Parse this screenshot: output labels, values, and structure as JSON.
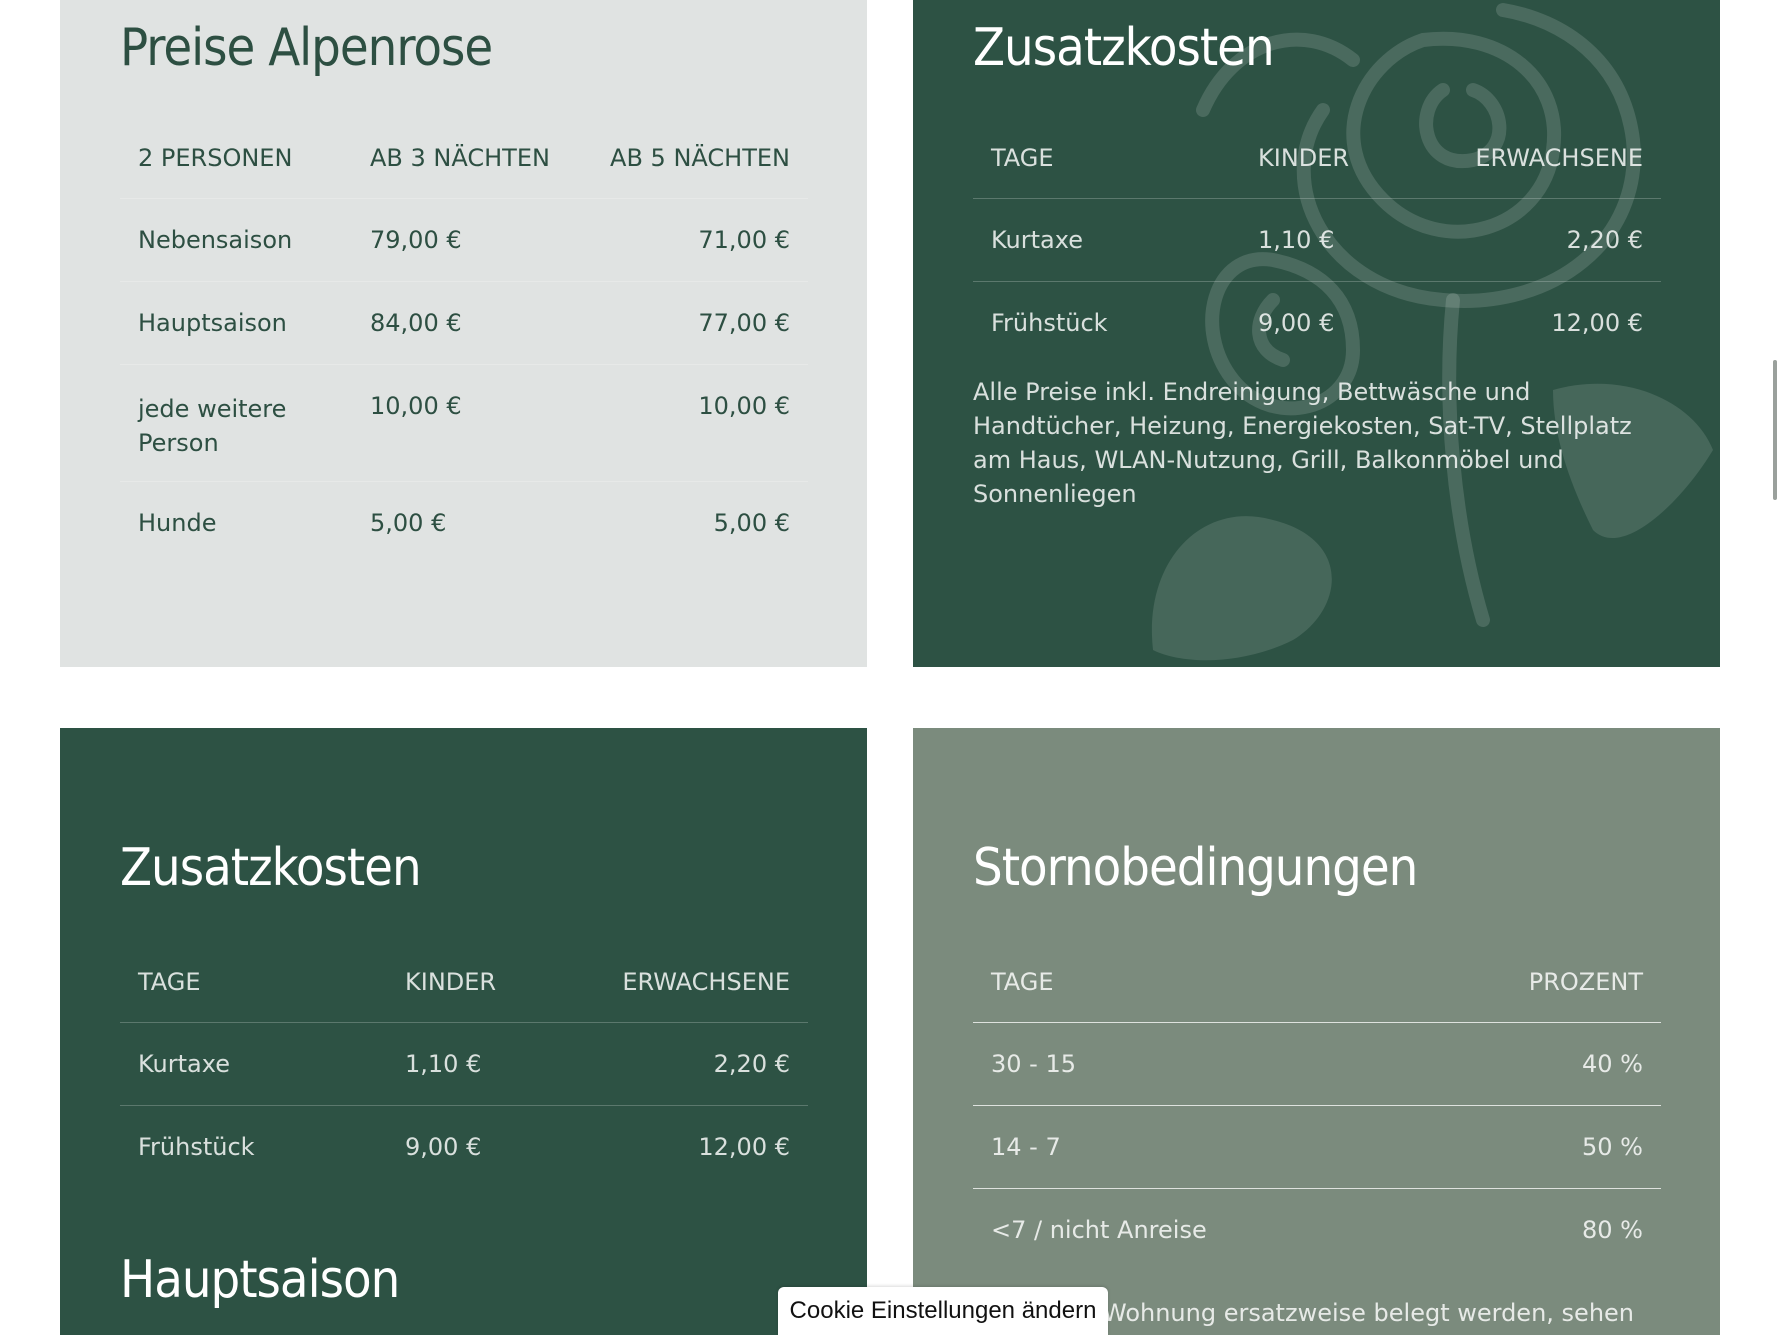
{
  "preise": {
    "title": "Preise Alpenrose",
    "headers": [
      "2 PERSONEN",
      "AB 3 NÄCHTEN",
      "AB 5 NÄCHTEN"
    ],
    "rows": [
      [
        "Nebensaison",
        "79,00 €",
        "71,00 €"
      ],
      [
        "Hauptsaison",
        "84,00 €",
        "77,00 €"
      ],
      [
        "jede weitere Person",
        "10,00 €",
        "10,00 €"
      ],
      [
        "Hunde",
        "5,00 €",
        "5,00 €"
      ]
    ]
  },
  "zusatzkosten_top": {
    "title": "Zusatzkosten",
    "headers": [
      "TAGE",
      "KINDER",
      "ERWACHSENE"
    ],
    "rows": [
      [
        "Kurtaxe",
        "1,10 €",
        "2,20 €"
      ],
      [
        "Frühstück",
        "9,00 €",
        "12,00 €"
      ]
    ],
    "note": "Alle Preise inkl. Endreinigung, Bettwäsche und Handtücher, Heizung, Energiekosten, Sat-TV, Stellplatz am Haus, WLAN-Nutzung, Grill, Balkonmöbel und Sonnenliegen"
  },
  "zusatzkosten_bottom": {
    "title": "Zusatzkosten",
    "headers": [
      "TAGE",
      "KINDER",
      "ERWACHSENE"
    ],
    "rows": [
      [
        "Kurtaxe",
        "1,10 €",
        "2,20 €"
      ],
      [
        "Frühstück",
        "9,00 €",
        "12,00 €"
      ]
    ],
    "subtitle": "Hauptsaison"
  },
  "storno": {
    "title": "Stornobedingungen",
    "headers": [
      "TAGE",
      "PROZENT"
    ],
    "rows": [
      [
        "30 - 15",
        "40 %"
      ],
      [
        "14 - 7",
        "50 %"
      ],
      [
        "<7 / nicht Anreise",
        "80 %"
      ]
    ],
    "note_fragment": "Wohnung ersatzweise belegt werden, sehen"
  },
  "cookie_button": "Cookie Einstellungen ändern",
  "colors": {
    "dark_green": "#2d5244",
    "light_gray": "#e0e3e2",
    "sage": "#7b8b7d"
  },
  "icons": [
    "rose-illustration-icon"
  ]
}
